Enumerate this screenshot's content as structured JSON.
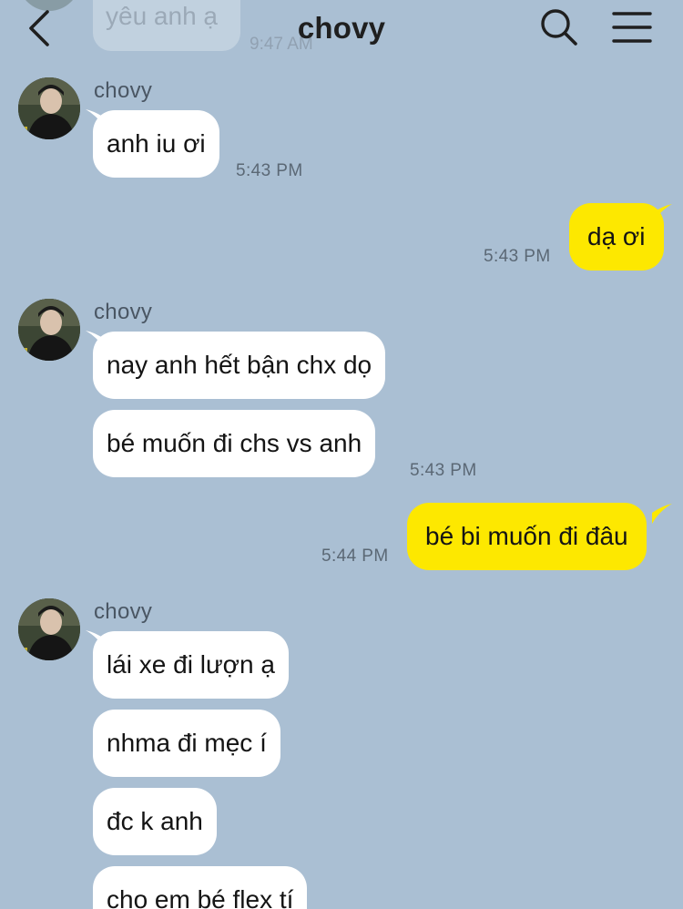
{
  "header": {
    "title": "chovy",
    "back_icon": "chevron-left-icon",
    "search_icon": "search-icon",
    "menu_icon": "hamburger-menu-icon"
  },
  "previous": {
    "text": "yêu anh ạ",
    "time": "9:47 AM"
  },
  "groups": [
    {
      "sender": "chovy",
      "messages": [
        "anh iu ơi"
      ],
      "time": "5:43 PM"
    },
    {
      "sender": "me",
      "messages": [
        "dạ ơi"
      ],
      "time": "5:43 PM"
    },
    {
      "sender": "chovy",
      "messages": [
        "nay anh hết bận chx dọ",
        "bé muốn đi chs vs anh"
      ],
      "time": "5:43 PM"
    },
    {
      "sender": "me",
      "messages": [
        "bé bi muốn đi đâu"
      ],
      "time": "5:44 PM"
    },
    {
      "sender": "chovy",
      "messages": [
        "lái xe đi lượn ạ",
        "nhma đi mẹc í",
        "đc k anh",
        "cho em bé flex tí"
      ]
    }
  ],
  "colors": {
    "background": "#aabfd3",
    "incoming_bubble": "#ffffff",
    "outgoing_bubble": "#fde800"
  }
}
